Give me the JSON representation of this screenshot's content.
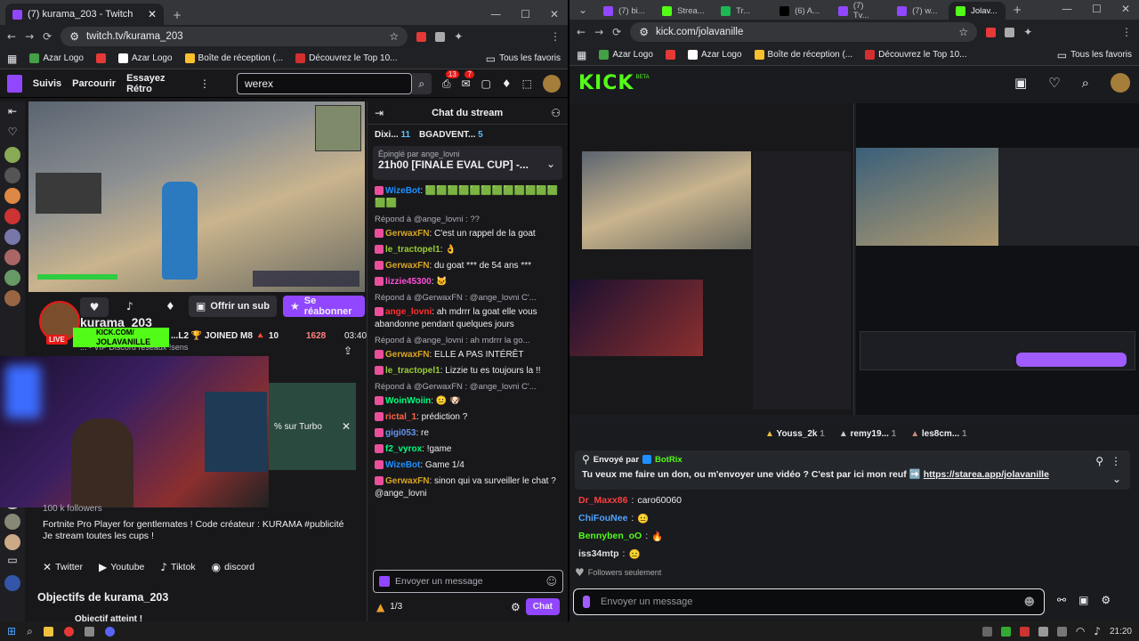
{
  "left_browser": {
    "tabs": [
      {
        "label": "(7) kurama_203 - Twitch"
      }
    ],
    "url": "twitch.tv/kurama_203",
    "bookmarks": [
      "Azar Logo",
      "Azar Logo",
      "Boîte de réception (...",
      "Découvrez le Top 10..."
    ],
    "all_bookmarks": "Tous les favoris"
  },
  "twitch": {
    "nav": [
      "Suivis",
      "Parcourir",
      "Essayez Rétro"
    ],
    "search_value": "werex",
    "notif_count": "13",
    "inbox_count": "7",
    "channel_name": "kurama_203",
    "live": "LIVE",
    "subscribe": "Offrir un sub",
    "resub": "Se réabonner",
    "viewers": "1628",
    "uptime": "03:40",
    "stream_title_fragment": "...L2 🏆 JOINED M8 🔺 10",
    "discord_fragment": "... - VIP Discord réseaux !sens",
    "kick_overlay_top": "KICK.COM/",
    "kick_overlay_name": "JOLAVANILLE",
    "turbo": "% sur Turbo",
    "followers": "100 k followers",
    "description": "Fortnite Pro Player for gentlemates ! Code créateur : KURAMA #publicité Je stream toutes les cups !",
    "socials": [
      "Twitter",
      "Youtube",
      "Tiktok",
      "discord"
    ],
    "goals_title": "Objectifs de kurama_203",
    "goal_done": "Objectif atteint !",
    "chat": {
      "header": "Chat du stream",
      "top_gifters": [
        {
          "name": "Dixi...",
          "count": "11"
        },
        {
          "name": "BGADVENT...",
          "count": "5"
        }
      ],
      "pinned_by": "Épinglé par",
      "pinned_user": "ange_lovni",
      "pinned_msg": "21h00 [FINALE EVAL CUP] -...",
      "messages": [
        {
          "reply": "",
          "user": "WizeBot",
          "color": "#1e90ff",
          "text": "🟩🟩🟩🟩🟩🟩🟩🟩🟩🟩🟩🟩🟩🟩"
        },
        {
          "reply": "Répond à @ange_lovni : ??",
          "user": "GerwaxFN",
          "color": "#daa520",
          "text": "C'est un rappel de la goat"
        },
        {
          "reply": "",
          "user": "le_tractopel1",
          "color": "#9acd32",
          "text": "👌"
        },
        {
          "reply": "",
          "user": "GerwaxFN",
          "color": "#daa520",
          "text": "du goat *** de 54 ans ***"
        },
        {
          "reply": "",
          "user": "lizzie45300",
          "color": "#ff4fd8",
          "text": "🐱"
        },
        {
          "reply": "Répond à @GerwaxFN : @ange_lovni C'...",
          "user": "ange_lovni",
          "color": "#ff2e2e",
          "text": "ah mdrrr la goat elle vous abandonne pendant quelques jours"
        },
        {
          "reply": "Répond à @ange_lovni : ah mdrrr la go...",
          "user": "GerwaxFN",
          "color": "#daa520",
          "text": "ELLE A PAS INTÉRÊT"
        },
        {
          "reply": "",
          "user": "le_tractopel1",
          "color": "#9acd32",
          "text": "Lizzie tu es toujours la !!"
        },
        {
          "reply": "Répond à @GerwaxFN : @ange_lovni C'...",
          "user": "WoinWoiin",
          "color": "#00ff7f",
          "text": "😐 🐶"
        },
        {
          "reply": "",
          "user": "rictal_1",
          "color": "#ff6347",
          "text": "prédiction ?"
        },
        {
          "reply": "",
          "user": "gigi053",
          "color": "#6495ed",
          "text": "re"
        },
        {
          "reply": "",
          "user": "f2_vyrox",
          "color": "#00ff7f",
          "text": "!game"
        },
        {
          "reply": "",
          "user": "WizeBot",
          "color": "#1e90ff",
          "text": "Game 1/4"
        },
        {
          "reply": "",
          "user": "GerwaxFN",
          "color": "#daa520",
          "text": "sinon qui va surveiller le chat ? @ange_lovni"
        }
      ],
      "input_placeholder": "Envoyer un message",
      "points": "1/3",
      "chat_btn": "Chat"
    }
  },
  "right_browser": {
    "tabs": [
      "(7) bi...",
      "Strea...",
      "Tr...",
      "(6) A...",
      "(7) Tv...",
      "(7) w...",
      "Jolav..."
    ],
    "url": "kick.com/jolavanille",
    "bookmarks": [
      "Azar Logo",
      "Azar Logo",
      "Boîte de réception (...",
      "Découvrez le Top 10..."
    ],
    "all_bookmarks": "Tous les favoris"
  },
  "kick": {
    "logo": "KICK",
    "beta": "BETA",
    "gifters": [
      {
        "name": "Youss_2k",
        "count": "1"
      },
      {
        "name": "remy19...",
        "count": "1"
      },
      {
        "name": "les8cm...",
        "count": "1"
      }
    ],
    "pinned_label": "Envoyé par",
    "pinned_user": "BotRix",
    "pinned_msg": "Tu veux me faire un don, ou m'envoyer une vidéo ? C'est par ici mon reuf ➡️",
    "pinned_link": "https://starea.app/jolavanille",
    "messages": [
      {
        "user": "Dr_Maxx86",
        "color": "#ff3e3e",
        "text": "caro60060"
      },
      {
        "user": "ChiFouNee",
        "color": "#4fa3ff",
        "text": "😐"
      },
      {
        "user": "Bennyben_oO",
        "color": "#53fc18",
        "text": "🔥"
      },
      {
        "user": "iss34mtp",
        "color": "#e0e0e0",
        "text": "😐"
      }
    ],
    "followers_only": "Followers seulement",
    "input_placeholder": "Envoyer un message"
  },
  "taskbar": {
    "time": "21:20"
  },
  "colors": {
    "twitch_purple": "#9147ff",
    "kick_green": "#53fc18"
  }
}
